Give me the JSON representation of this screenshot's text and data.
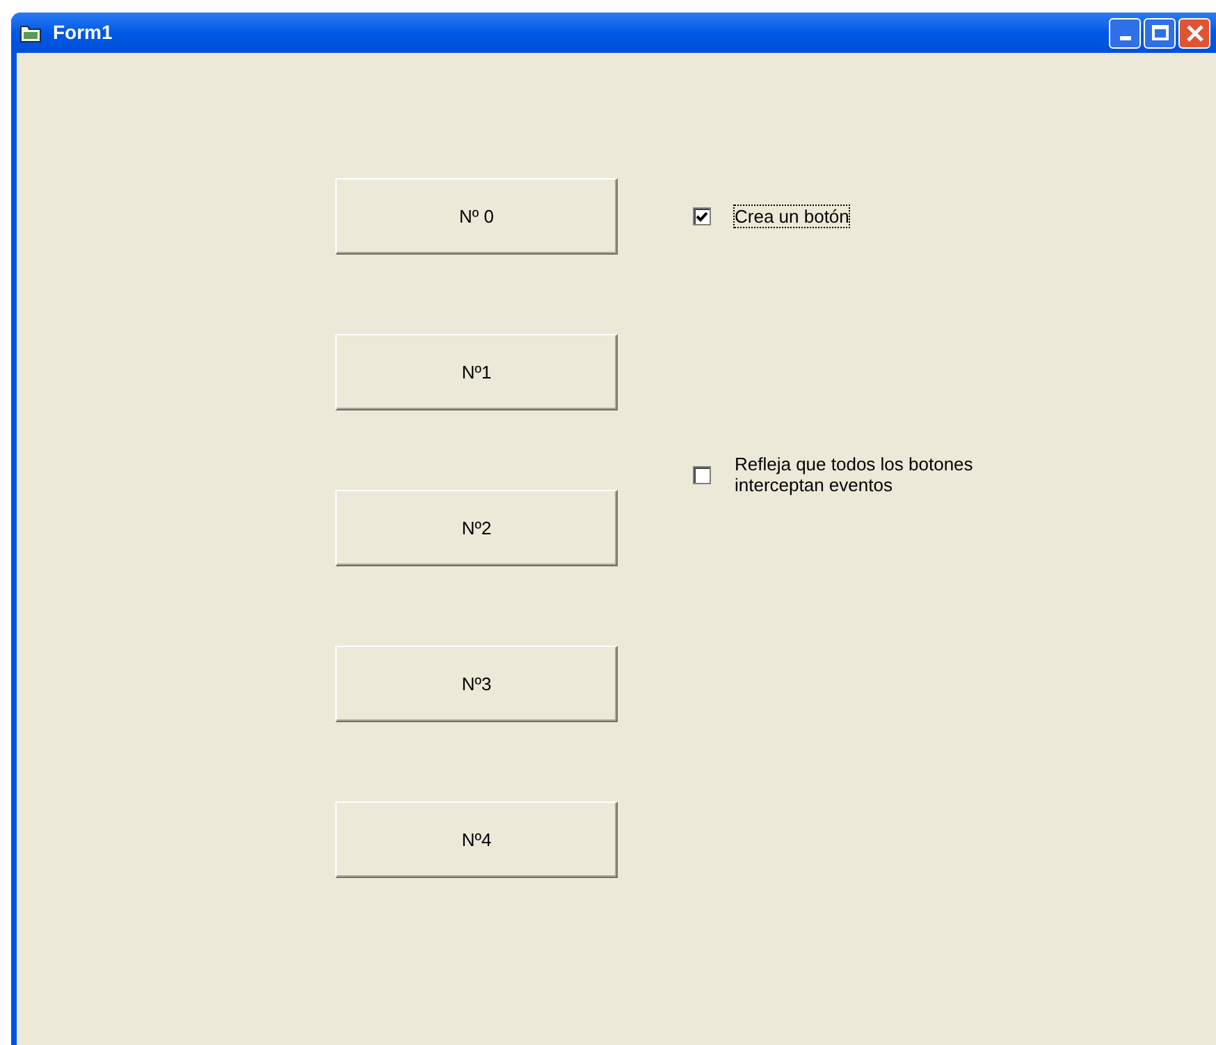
{
  "window": {
    "title": "Form1"
  },
  "buttons": [
    {
      "label": "Nº 0"
    },
    {
      "label": "Nº1"
    },
    {
      "label": "Nº2"
    },
    {
      "label": "Nº3"
    },
    {
      "label": "Nº4"
    }
  ],
  "checkboxes": [
    {
      "label": "Crea un botón",
      "checked": true,
      "focused": true
    },
    {
      "label": "Refleja que todos los botones interceptan eventos",
      "checked": false,
      "focused": false
    }
  ]
}
